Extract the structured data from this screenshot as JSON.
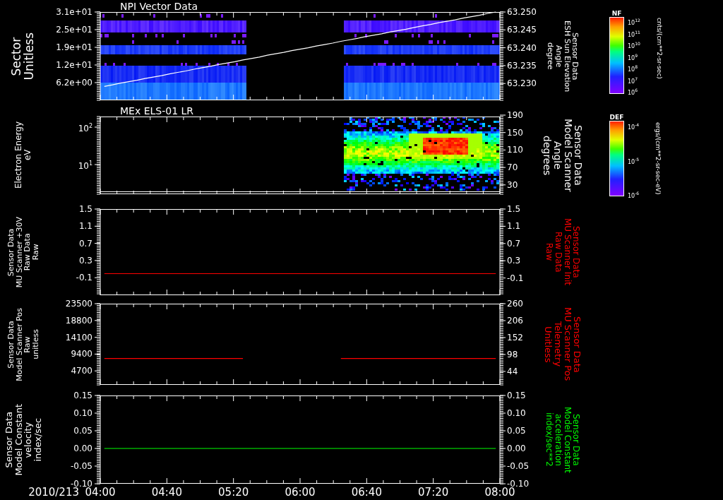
{
  "panels": [
    {
      "kind": "bands",
      "title": "NPI Vector Data",
      "left_axis": {
        "label": "Sector\nUnitless",
        "ticks": [
          "3.1e+01",
          "2.5e+01",
          "1.9e+01",
          "1.2e+01",
          "6.2e+00"
        ]
      },
      "right_axis": {
        "label": "Sensor Data\nESH Sun Elevation\nAngle\ndegree",
        "color": "#ffffff"
      },
      "colorbar": {
        "title": "NF",
        "labels": [
          "10$^{12}$",
          "10$^{11}$",
          "10$^{10}$",
          "10$^{9}$",
          "10$^{8}$",
          "10$^{7}$",
          "10$^{6}$"
        ],
        "units": "cnts/(cm**2-sr-sec)"
      },
      "chart_data": {
        "type": "line",
        "categories": [
          null,
          null,
          null,
          null,
          null,
          null,
          null,
          null,
          null,
          null,
          null,
          null,
          null,
          null,
          null,
          null,
          null,
          null,
          null,
          null,
          null,
          null,
          null,
          null,
          null,
          null,
          null,
          null,
          null,
          null,
          null,
          null,
          null,
          null,
          null,
          null,
          null,
          null,
          null,
          null,
          null,
          null,
          null,
          null,
          null,
          null,
          null,
          null,
          null
        ],
        "ylim": [
          63.2253,
          63.25
        ],
        "yticks": [
          {
            "value": 63.25,
            "label": "63.250"
          },
          {
            "value": 63.245,
            "label": "63.245"
          },
          {
            "value": 63.24,
            "label": "63.240"
          },
          {
            "value": 63.235,
            "label": "63.235"
          },
          {
            "value": 63.23,
            "label": "63.230"
          }
        ],
        "series": [
          {
            "color": "#ffffff",
            "values": [
              63.2292,
              63.2296,
              63.2301,
              63.2305,
              63.2309,
              63.2314,
              63.2318,
              63.2322,
              63.2327,
              63.2331,
              63.2335,
              63.234,
              63.2344,
              63.2348,
              63.2353,
              63.2357,
              63.2361,
              63.2366,
              63.237,
              63.2374,
              63.2379,
              63.2383,
              63.2387,
              63.2392,
              63.2396,
              63.24,
              63.2405,
              63.2409,
              63.2413,
              63.2418,
              63.2422,
              63.2426,
              63.2431,
              63.2435,
              63.2439,
              63.2444,
              63.2448,
              63.2452,
              63.2457,
              63.2461,
              63.2465,
              63.247,
              63.2474,
              63.2478,
              63.2483,
              63.2487,
              63.2491,
              63.2496,
              63.25
            ]
          }
        ]
      }
    },
    {
      "kind": "energy",
      "title": "MEx ELS-01 LR",
      "left_axis": {
        "label": "Electron Energy\neV",
        "ticks": [
          "10$^{2}$",
          "10$^{1}$"
        ]
      },
      "right_axis": {
        "label": "Sensor Data\nModel Scanner\nAngle\ndegrees",
        "color": "#ffffff",
        "ticks": [
          "190",
          "150",
          "110",
          "70",
          "30"
        ]
      },
      "colorbar": {
        "title": "DEF",
        "labels": [
          "10$^{-4}$",
          "10$^{-5}$",
          "10$^{-6}$"
        ],
        "units": "ergs/(cm**2-sr-sec-eV)"
      }
    },
    {
      "kind": "line",
      "left_axis": {
        "label": "Sensor Data\nMU Scanner +30V\nRaw Data\nRaw",
        "ticks": [
          "1.5",
          "1.1",
          "0.7",
          "0.3",
          "-0.1"
        ]
      },
      "right_axis": {
        "label": "Sensor Data\nMU Scanner Init\nRaw Data\nRaw",
        "color": "#ff0000"
      },
      "chart_data": {
        "type": "line",
        "categories": [
          null,
          null,
          null,
          null,
          null,
          null,
          null,
          null,
          null,
          null,
          null,
          null,
          null,
          null,
          null,
          null,
          null,
          null,
          null,
          null,
          null,
          null,
          null,
          null,
          null,
          null,
          null,
          null,
          null,
          null,
          null,
          null,
          null,
          null,
          null,
          null,
          null,
          null,
          null,
          null,
          null,
          null,
          null,
          null,
          null,
          null,
          null,
          null,
          null
        ],
        "ylim": [
          -0.5,
          1.5
        ],
        "yticks": [
          {
            "value": 1.5,
            "label": "1.5"
          },
          {
            "value": 1.1,
            "label": "1.1"
          },
          {
            "value": 0.7,
            "label": "0.7"
          },
          {
            "value": 0.3,
            "label": "0.3"
          },
          {
            "value": -0.1,
            "label": "-0.1"
          }
        ],
        "series": [
          {
            "color": "#ff0000",
            "values": [
              0,
              0,
              0,
              0,
              0,
              0,
              0,
              0,
              0,
              0,
              0,
              0,
              0,
              0,
              0,
              0,
              0,
              0,
              0,
              0,
              0,
              0,
              0,
              0,
              0,
              0,
              0,
              0,
              0,
              0,
              0,
              0,
              0,
              0,
              0,
              0,
              0,
              0,
              0,
              0,
              0,
              0,
              0,
              0,
              0,
              0,
              0,
              0,
              0
            ]
          }
        ]
      }
    },
    {
      "kind": "line",
      "left_axis": {
        "label": "Sensor Data\nModel Scanner Pos\nRaw\nunitless",
        "ticks": [
          "23500",
          "18800",
          "14100",
          "9400",
          "4700"
        ]
      },
      "right_axis": {
        "label": "Sensor Data\nMU Scanner Pos\nTelemetry\nUnitless",
        "color": "#ff0000"
      },
      "chart_data": {
        "type": "line",
        "categories": [
          null,
          null,
          null,
          null,
          null,
          null,
          null,
          null,
          null,
          null,
          null,
          null,
          null,
          null,
          null,
          null,
          null,
          null,
          null,
          null,
          null,
          null,
          null,
          null,
          null,
          null,
          null,
          null,
          null,
          null,
          null,
          null,
          null,
          null,
          null,
          null,
          null,
          null,
          null,
          null,
          null,
          null,
          null,
          null,
          null,
          null,
          null,
          null,
          null
        ],
        "ylim": [
          1,
          260
        ],
        "yticks": [
          {
            "value": 260,
            "label": "260"
          },
          {
            "value": 206,
            "label": "206"
          },
          {
            "value": 152,
            "label": "152"
          },
          {
            "value": 98,
            "label": "98"
          },
          {
            "value": 44,
            "label": "44"
          }
        ],
        "series": [
          {
            "color": "#ff0000",
            "values": [
              85,
              85,
              85,
              85,
              85,
              85,
              85,
              85,
              85,
              85,
              85,
              85,
              85,
              85,
              85,
              85,
              85,
              85,
              null,
              null,
              null,
              null,
              null,
              null,
              null,
              null,
              null,
              null,
              null,
              85,
              85,
              85,
              85,
              85,
              85,
              85,
              85,
              85,
              85,
              85,
              85,
              85,
              85,
              85,
              85,
              85,
              85,
              85,
              85
            ]
          }
        ]
      }
    },
    {
      "kind": "line",
      "left_axis": {
        "label": "Sensor Data\nModel Constant\nvelocity\nindex/sec",
        "ticks": [
          "0.15",
          "0.10",
          "0.05",
          "0.00",
          "-0.05",
          "-0.10"
        ]
      },
      "right_axis": {
        "label": "Sensor Data\nModel Constant\nacceleration\nindex/sec**2",
        "color": "#00ff00"
      },
      "chart_data": {
        "type": "line",
        "categories": [
          null,
          null,
          null,
          null,
          null,
          null,
          null,
          null,
          null,
          null,
          null,
          null,
          null,
          null,
          null,
          null,
          null,
          null,
          null,
          null,
          null,
          null,
          null,
          null,
          null,
          null,
          null,
          null,
          null,
          null,
          null,
          null,
          null,
          null,
          null,
          null,
          null,
          null,
          null,
          null,
          null,
          null,
          null,
          null,
          null,
          null,
          null,
          null,
          null
        ],
        "ylim": [
          -0.1,
          0.15
        ],
        "yticks": [
          {
            "value": 0.15,
            "label": "0.15"
          },
          {
            "value": 0.1,
            "label": "0.10"
          },
          {
            "value": 0.05,
            "label": "0.05"
          },
          {
            "value": 0,
            "label": "0.00"
          },
          {
            "value": -0.05,
            "label": "-0.05"
          },
          {
            "value": -0.1,
            "label": "-0.10"
          }
        ],
        "series": [
          {
            "color": "#00ff00",
            "values": [
              0,
              0,
              0,
              0,
              0,
              0,
              0,
              0,
              0,
              0,
              0,
              0,
              0,
              0,
              0,
              0,
              0,
              0,
              0,
              0,
              0,
              0,
              0,
              0,
              0,
              0,
              0,
              0,
              0,
              0,
              0,
              0,
              0,
              0,
              0,
              0,
              0,
              0,
              0,
              0,
              0,
              0,
              0,
              0,
              0,
              0,
              0,
              0,
              0
            ]
          }
        ]
      }
    }
  ],
  "time_axis": {
    "date": "2010/213",
    "labels": [
      "04:00",
      "04:40",
      "05:20",
      "06:00",
      "06:40",
      "07:20",
      "08:00"
    ]
  }
}
